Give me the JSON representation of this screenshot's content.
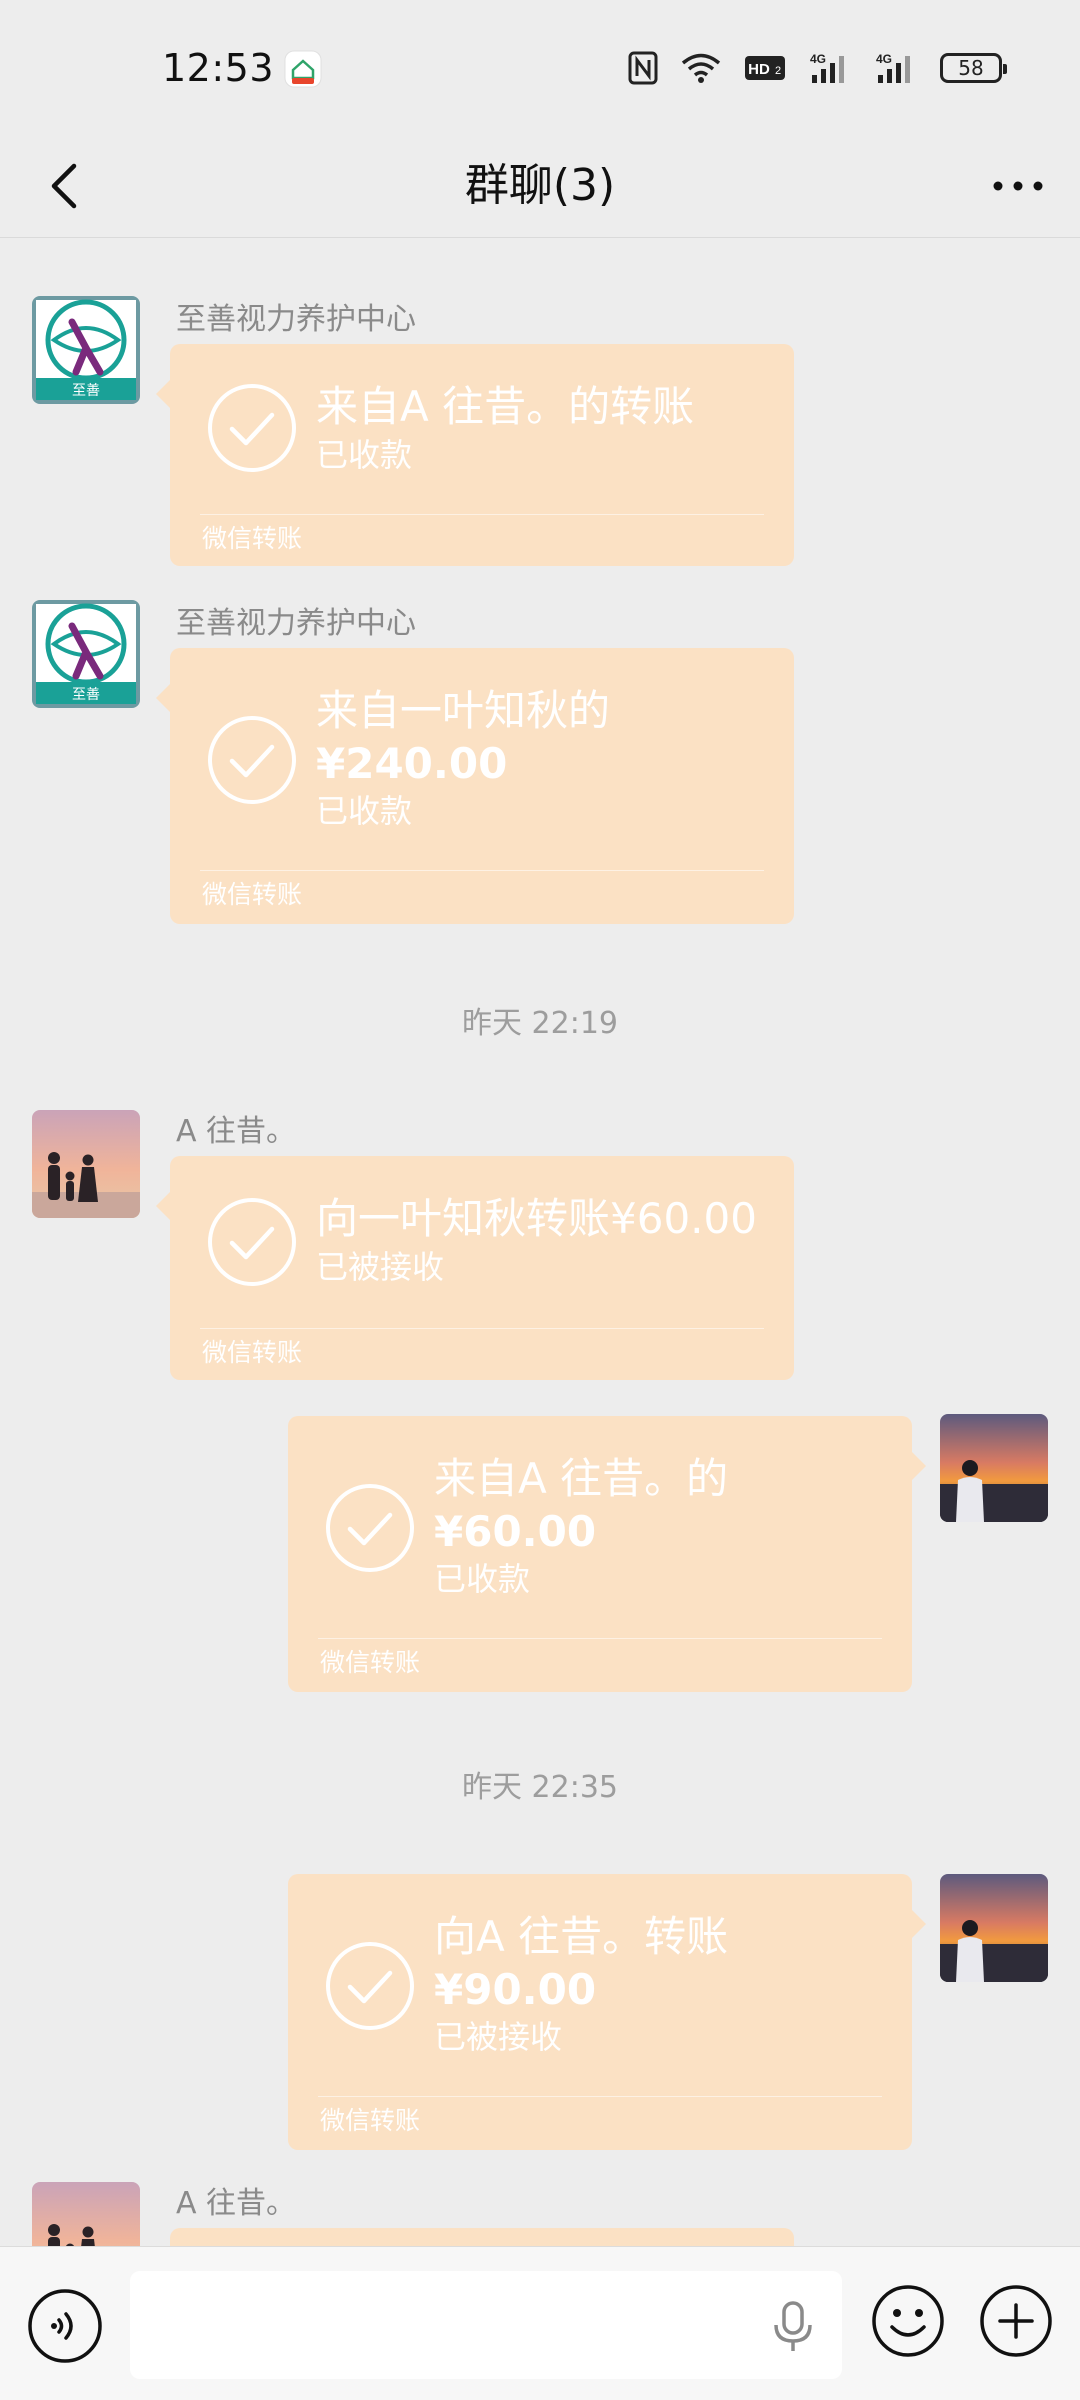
{
  "status_bar": {
    "time": "12:53",
    "battery": "58",
    "network_1": "4G",
    "network_2": "4G",
    "hd_label": "HD"
  },
  "nav": {
    "title": "群聊(3)"
  },
  "colors": {
    "background": "#EDEDED",
    "transfer_card": "#FBE1C4",
    "text_on_card": "#FFFFFF",
    "meta_text": "#8A8A8A"
  },
  "messages": [
    {
      "type": "transfer",
      "side": "left",
      "sender": "至善视力养护中心",
      "title": "来自A   往昔。的转账",
      "amount": "",
      "status": "已收款",
      "footer": "微信转账",
      "avatar_icon": "logo-avatar"
    },
    {
      "type": "transfer",
      "side": "left",
      "sender": "至善视力养护中心",
      "title": "来自一叶知秋的",
      "amount": "¥240.00",
      "status": "已收款",
      "footer": "微信转账",
      "avatar_icon": "logo-avatar"
    },
    {
      "type": "timestamp",
      "text": "昨天 22:19"
    },
    {
      "type": "transfer",
      "side": "left",
      "sender": "A   往昔。",
      "title": "向一叶知秋转账¥60.00",
      "amount": "",
      "status": "已被接收",
      "footer": "微信转账",
      "avatar_icon": "family-sunset-avatar"
    },
    {
      "type": "transfer",
      "side": "right",
      "title": "来自A   往昔。的",
      "amount": "¥60.00",
      "status": "已收款",
      "footer": "微信转账",
      "avatar_icon": "sunset-person-avatar"
    },
    {
      "type": "timestamp",
      "text": "昨天 22:35"
    },
    {
      "type": "transfer",
      "side": "right",
      "title": "向A   往昔。转账",
      "amount": "¥90.00",
      "status": "已被接收",
      "footer": "微信转账",
      "avatar_icon": "sunset-person-avatar"
    },
    {
      "type": "transfer",
      "side": "left",
      "sender": "A   往昔。",
      "title": "",
      "amount": "",
      "status": "",
      "footer": "",
      "avatar_icon": "family-sunset-avatar"
    }
  ],
  "input_bar": {
    "placeholder": "",
    "value": "",
    "icons": [
      "voice-icon",
      "microphone-icon",
      "emoji-icon",
      "plus-icon"
    ]
  }
}
